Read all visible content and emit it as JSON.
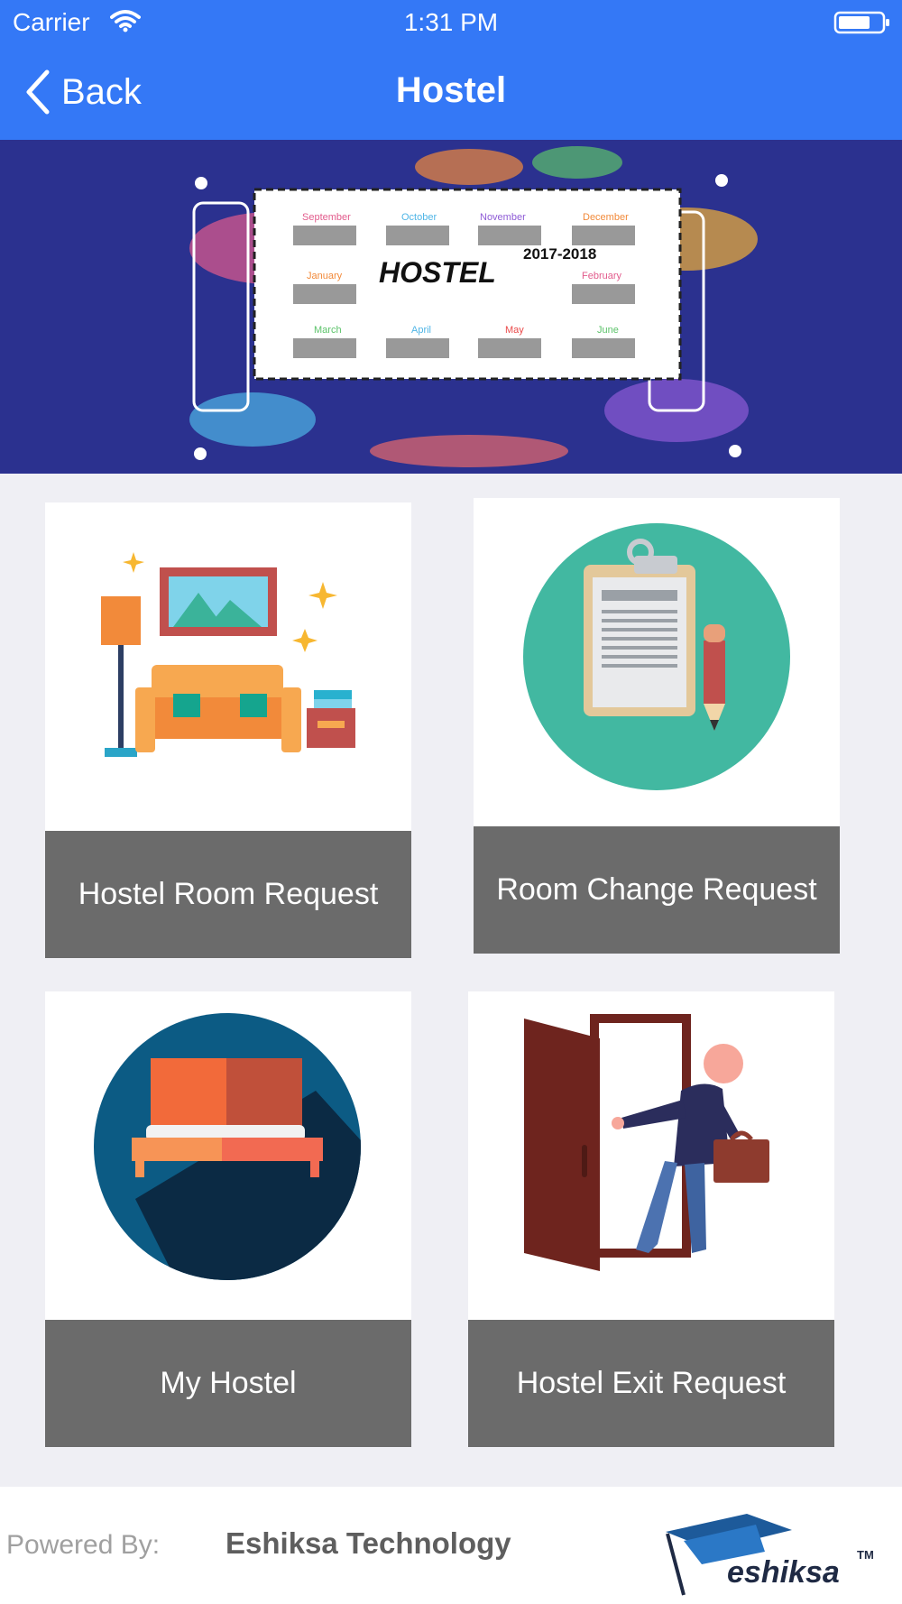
{
  "status_bar": {
    "carrier": "Carrier",
    "time": "1:31 PM"
  },
  "nav": {
    "back_label": "Back",
    "title": "Hostel"
  },
  "banner": {
    "title": "HOSTEL",
    "years": "2017-2018",
    "months": [
      "September",
      "October",
      "November",
      "December",
      "January",
      "February",
      "March",
      "April",
      "May",
      "June"
    ]
  },
  "tiles": [
    {
      "label": "Hostel Room Request",
      "icon": "living-room-icon"
    },
    {
      "label": "Room Change Request",
      "icon": "clipboard-pencil-icon"
    },
    {
      "label": "My Hostel",
      "icon": "bed-icon"
    },
    {
      "label": "Hostel Exit Request",
      "icon": "exit-door-icon"
    }
  ],
  "footer": {
    "powered_by": "Powered By:",
    "company": "Eshiksa Technology",
    "logo_text": "eshiksa",
    "logo_tm": "TM"
  },
  "colors": {
    "primary": "#3478f6",
    "banner_bg": "#2b318f",
    "caption_bg": "#6b6b6b",
    "page_bg": "#efeff4"
  }
}
